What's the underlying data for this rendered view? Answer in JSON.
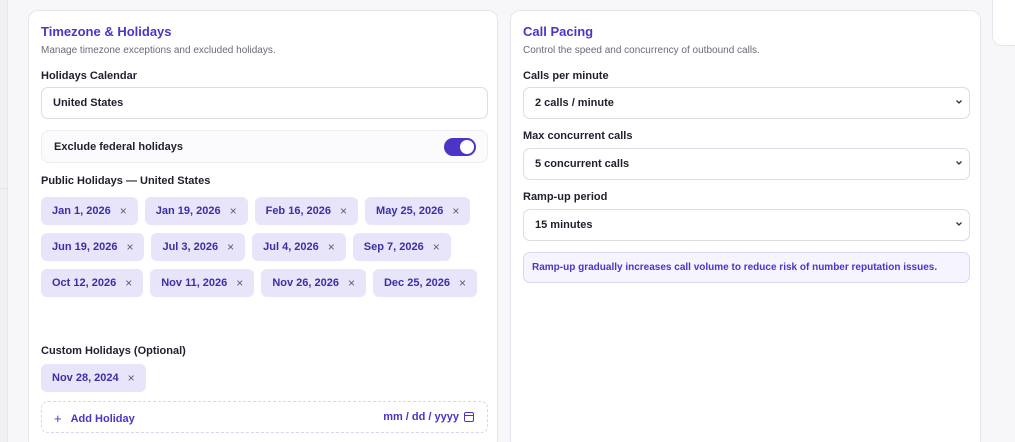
{
  "timezone": {
    "title": "Timezone & Holidays",
    "subtitle": "Manage timezone exceptions and excluded holidays.",
    "calendar_label": "Holidays Calendar",
    "calendar_value": "United States",
    "toggle_label": "Exclude federal holidays",
    "toggle_on": true,
    "public_label": "Public Holidays — United States",
    "public_holidays": [
      "Jan 1, 2026",
      "Jan 19, 2026",
      "Feb 16, 2026",
      "May 25, 2026",
      "Jun 19, 2026",
      "Jul 3, 2026",
      "Jul 4, 2026",
      "Sep 7, 2026",
      "Oct 12, 2026",
      "Nov 11, 2026",
      "Nov 26, 2026",
      "Dec 25, 2026"
    ],
    "custom_label": "Custom Holidays (Optional)",
    "custom_holidays": [
      "Nov 28, 2024"
    ],
    "add_holiday_label": "Add Holiday",
    "date_placeholder": "mm / dd / yyyy",
    "remove_glyph": "×",
    "plus_glyph": "+"
  },
  "pacing": {
    "title": "Call Pacing",
    "subtitle": "Control the speed and concurrency of outbound calls.",
    "cpm_label": "Calls per minute",
    "cpm_value": "2 calls / minute",
    "concurrent_label": "Max concurrent calls",
    "concurrent_value": "5 concurrent calls",
    "rampup_label": "Ramp-up period",
    "rampup_value": "15 minutes",
    "info_text": "Ramp-up gradually increases call volume to reduce risk of number reputation issues."
  },
  "colors": {
    "accent": "#4b34c6",
    "chip_bg": "#e8e5fb"
  }
}
